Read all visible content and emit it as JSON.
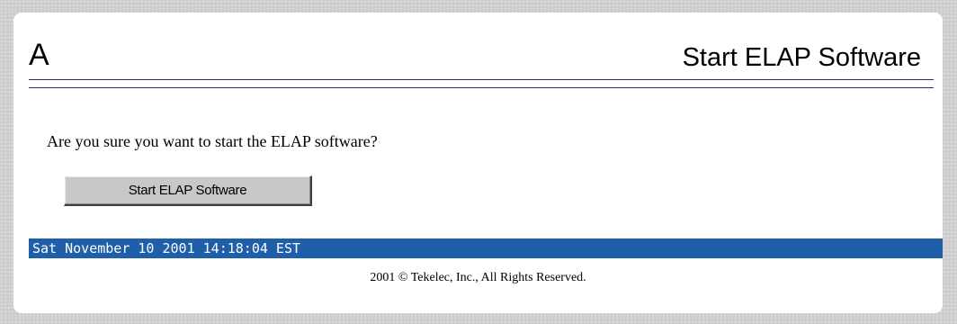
{
  "header": {
    "server_letter": "A",
    "title": "Start ELAP Software"
  },
  "main": {
    "prompt": "Are you sure you want to start the ELAP software?",
    "start_button_label": "Start ELAP Software"
  },
  "footer": {
    "status_timestamp": "Sat November 10 2001 14:18:04 EST",
    "copyright": "2001 © Tekelec, Inc., All Rights Reserved."
  },
  "colors": {
    "status_bar_bg": "#1f5ea8",
    "header_rule": "#2a2a7a",
    "page_bg": "#cfcdd0"
  }
}
